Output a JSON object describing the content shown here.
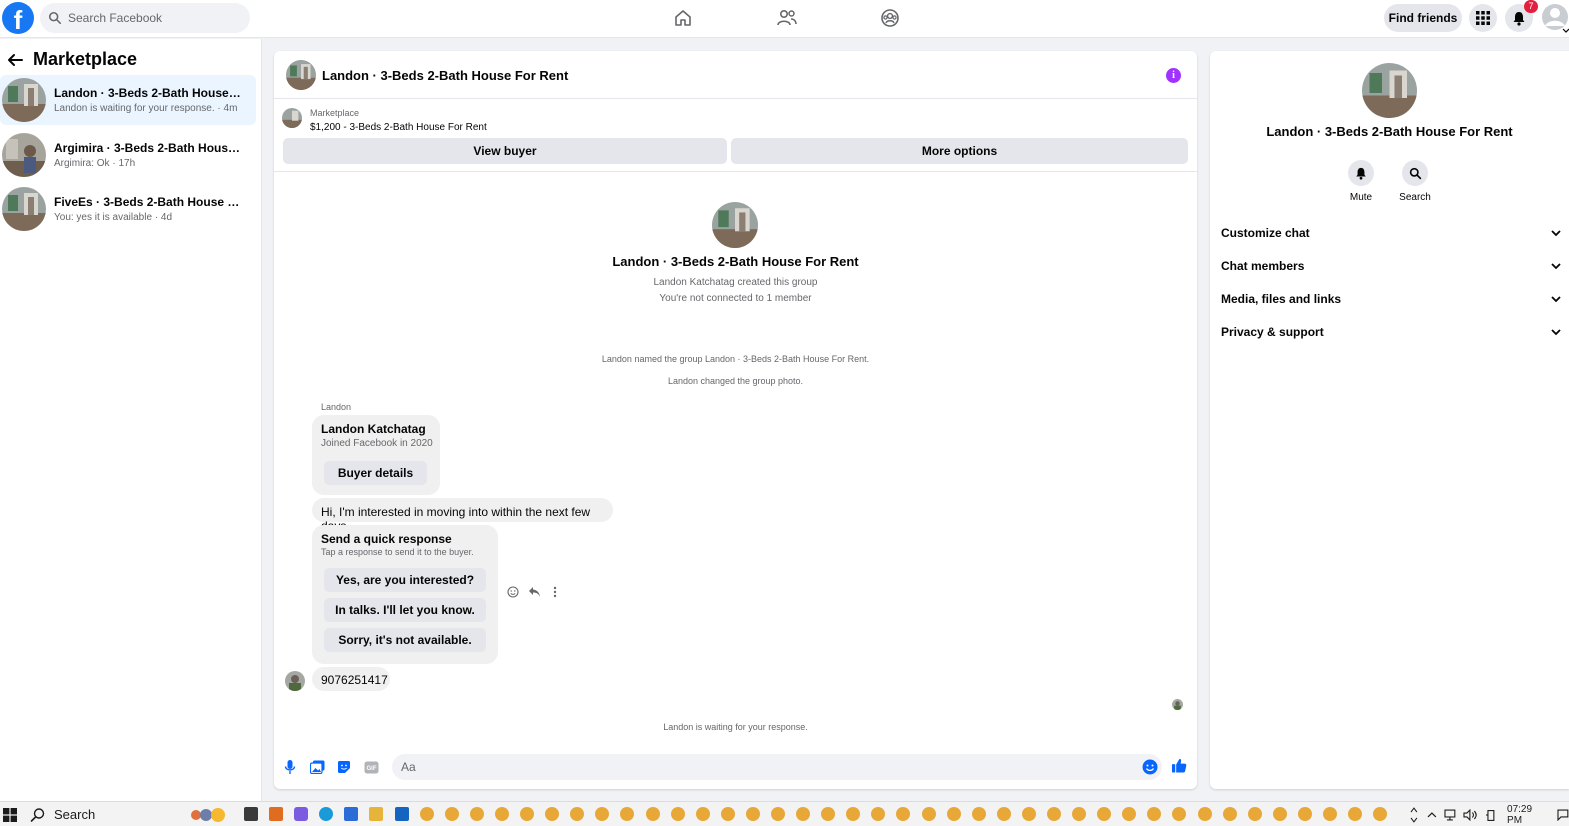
{
  "header": {
    "logo_letter": "f",
    "search_placeholder": "Search Facebook",
    "find_friends_label": "Find friends",
    "notification_count": "7"
  },
  "sidebar": {
    "title": "Marketplace",
    "conversations": [
      {
        "name": "Landon · 3-Beds 2-Bath House For...",
        "preview": "Landon is waiting for your response. · 4m"
      },
      {
        "name": "Argimira · 3-Beds 2-Bath House Fo...",
        "preview": "Argimira: Ok · 17h"
      },
      {
        "name": "FiveEs · 3-Beds 2-Bath House For ...",
        "preview": "You: yes it is available · 4d"
      }
    ]
  },
  "chat": {
    "title": "Landon · 3-Beds 2-Bath House For Rent",
    "info_symbol": "i",
    "marketplace_label": "Marketplace",
    "listing": "$1,200 - 3-Beds 2-Bath House For Rent",
    "view_buyer_label": "View buyer",
    "more_options_label": "More options",
    "intro_title": "Landon · 3-Beds 2-Bath House For Rent",
    "intro_created": "Landon Katchatag created this group",
    "intro_connected": "You're not connected to 1 member",
    "sys_named": "Landon named the group Landon · 3-Beds 2-Bath House For Rent.",
    "sys_photo": "Landon changed the group photo.",
    "sender": "Landon",
    "buyer_card": {
      "name": "Landon Katchatag",
      "joined": "Joined Facebook in 2020",
      "button": "Buyer details"
    },
    "message_1": "Hi, I'm interested in moving into within the next few days",
    "quick_response": {
      "title": "Send a quick response",
      "subtitle": "Tap a response to send it to the buyer.",
      "options": [
        "Yes, are you interested?",
        "In talks. I'll let you know.",
        "Sorry, it's not available."
      ]
    },
    "message_2": "9076251417",
    "waiting": "Landon is waiting for your response.",
    "composer_placeholder": "Aa"
  },
  "right_panel": {
    "title": "Landon · 3-Beds 2-Bath House For Rent",
    "mute_label": "Mute",
    "search_label": "Search",
    "sections": [
      "Customize chat",
      "Chat members",
      "Media, files and links",
      "Privacy & support"
    ]
  },
  "taskbar": {
    "search_label": "Search",
    "time": "07:29 PM"
  },
  "colors": {
    "brand": "#1877f2",
    "info_purple": "#a033ff",
    "active_conversation": "#ebf5ff",
    "notification_red": "#e41e3f"
  }
}
